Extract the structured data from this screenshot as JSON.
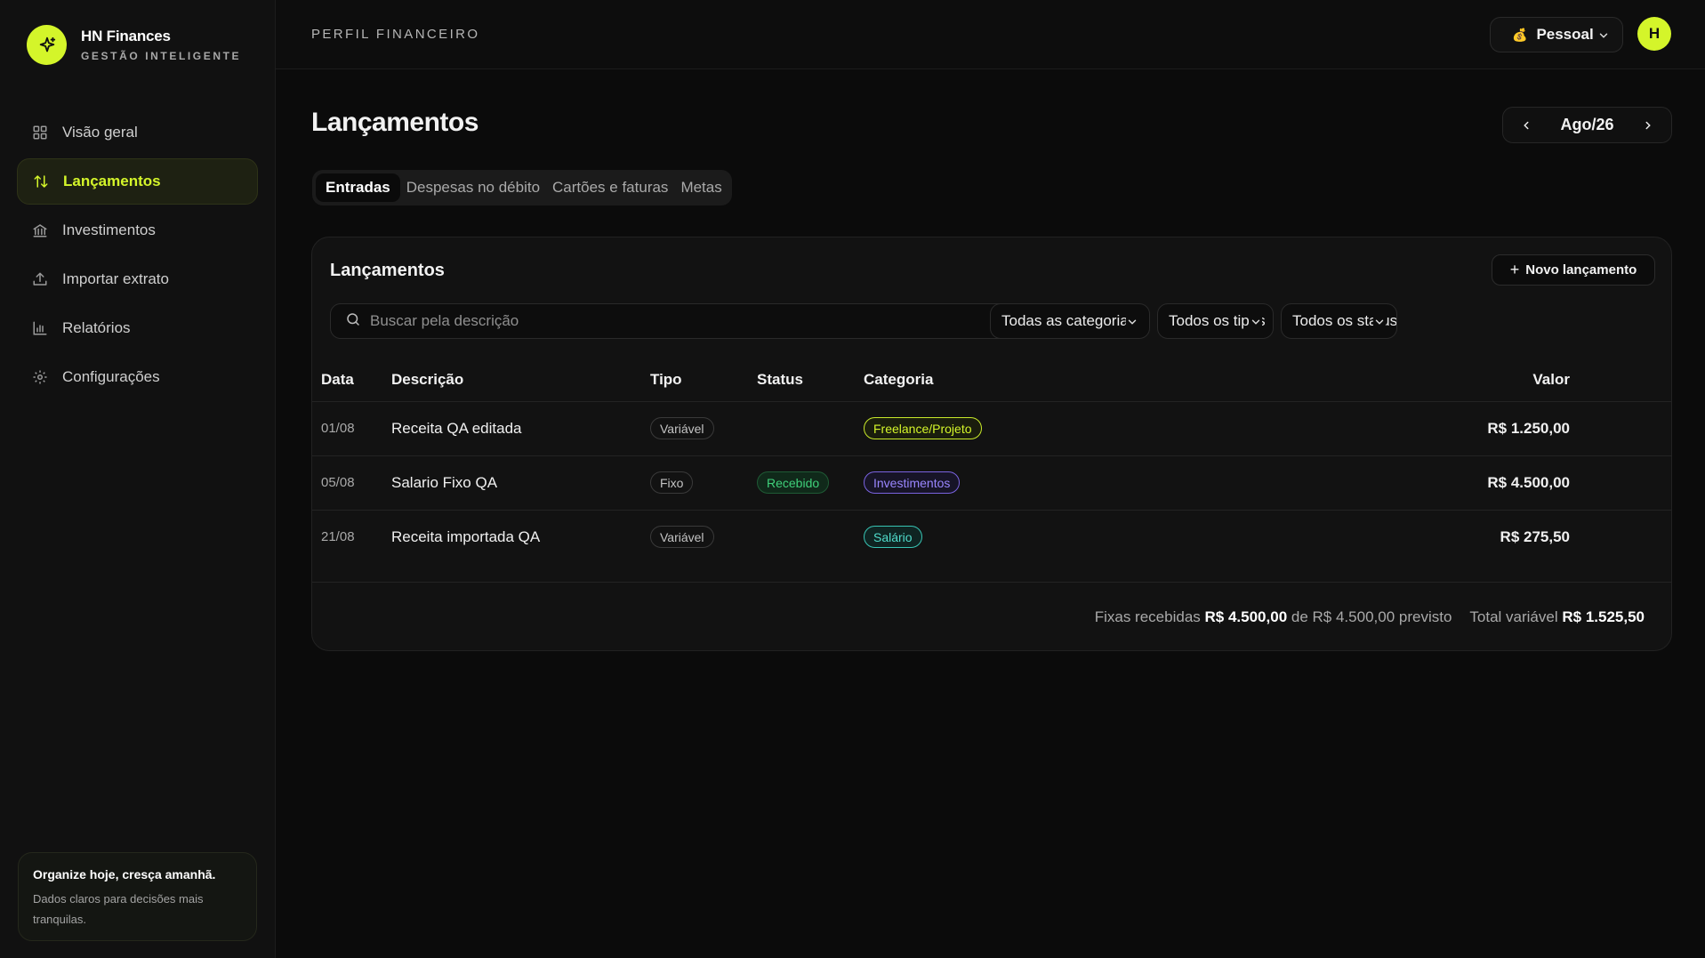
{
  "brand": {
    "name": "HN Finances",
    "subtitle": "GESTÃO INTELIGENTE",
    "accent": "#d4f52a"
  },
  "sidebar": {
    "items": [
      {
        "label": "Visão geral",
        "icon": "grid-icon",
        "active": false
      },
      {
        "label": "Lançamentos",
        "icon": "arrows-up-down-icon",
        "active": true
      },
      {
        "label": "Investimentos",
        "icon": "bank-icon",
        "active": false
      },
      {
        "label": "Importar extrato",
        "icon": "upload-icon",
        "active": false
      },
      {
        "label": "Relatórios",
        "icon": "bar-chart-icon",
        "active": false
      },
      {
        "label": "Configurações",
        "icon": "gear-icon",
        "active": false
      }
    ],
    "tip": {
      "title": "Organize hoje, cresça amanhã.",
      "body": "Dados claros para decisões mais tranquilas."
    }
  },
  "topbar": {
    "title": "PERFIL FINANCEIRO",
    "profile": {
      "emoji": "💰",
      "label": "Pessoal"
    },
    "avatar_initial": "H"
  },
  "main": {
    "title": "Lançamentos",
    "month": "Ago/26",
    "tabs": [
      {
        "label": "Entradas",
        "active": true
      },
      {
        "label": "Despesas no débito",
        "active": false
      },
      {
        "label": "Cartões e faturas",
        "active": false
      },
      {
        "label": "Metas",
        "active": false
      }
    ],
    "card": {
      "title": "Lançamentos",
      "new_button": "Novo lançamento",
      "search_placeholder": "Buscar pela descrição",
      "filters": {
        "category": "Todas as categorias",
        "type": "Todos os tipos",
        "status": "Todos os status"
      },
      "columns": {
        "date": "Data",
        "description": "Descrição",
        "type": "Tipo",
        "status": "Status",
        "category": "Categoria",
        "value": "Valor"
      },
      "rows": [
        {
          "date": "01/08",
          "description": "Receita QA editada",
          "type": "Variável",
          "status": "",
          "category": "Freelance/Projeto",
          "value": "R$ 1.250,00"
        },
        {
          "date": "05/08",
          "description": "Salario Fixo QA",
          "type": "Fixo",
          "status": "Recebido",
          "category": "Investimentos",
          "value": "R$ 4.500,00"
        },
        {
          "date": "21/08",
          "description": "Receita importada QA",
          "type": "Variável",
          "status": "",
          "category": "Salário",
          "value": "R$ 275,50"
        }
      ],
      "footer": {
        "fixed_label": "Fixas recebidas",
        "fixed_value": "R$ 4.500,00",
        "of_label": "de R$ 4.500,00 previsto",
        "variable_label": "Total variável",
        "variable_value": "R$ 1.525,50"
      }
    }
  }
}
